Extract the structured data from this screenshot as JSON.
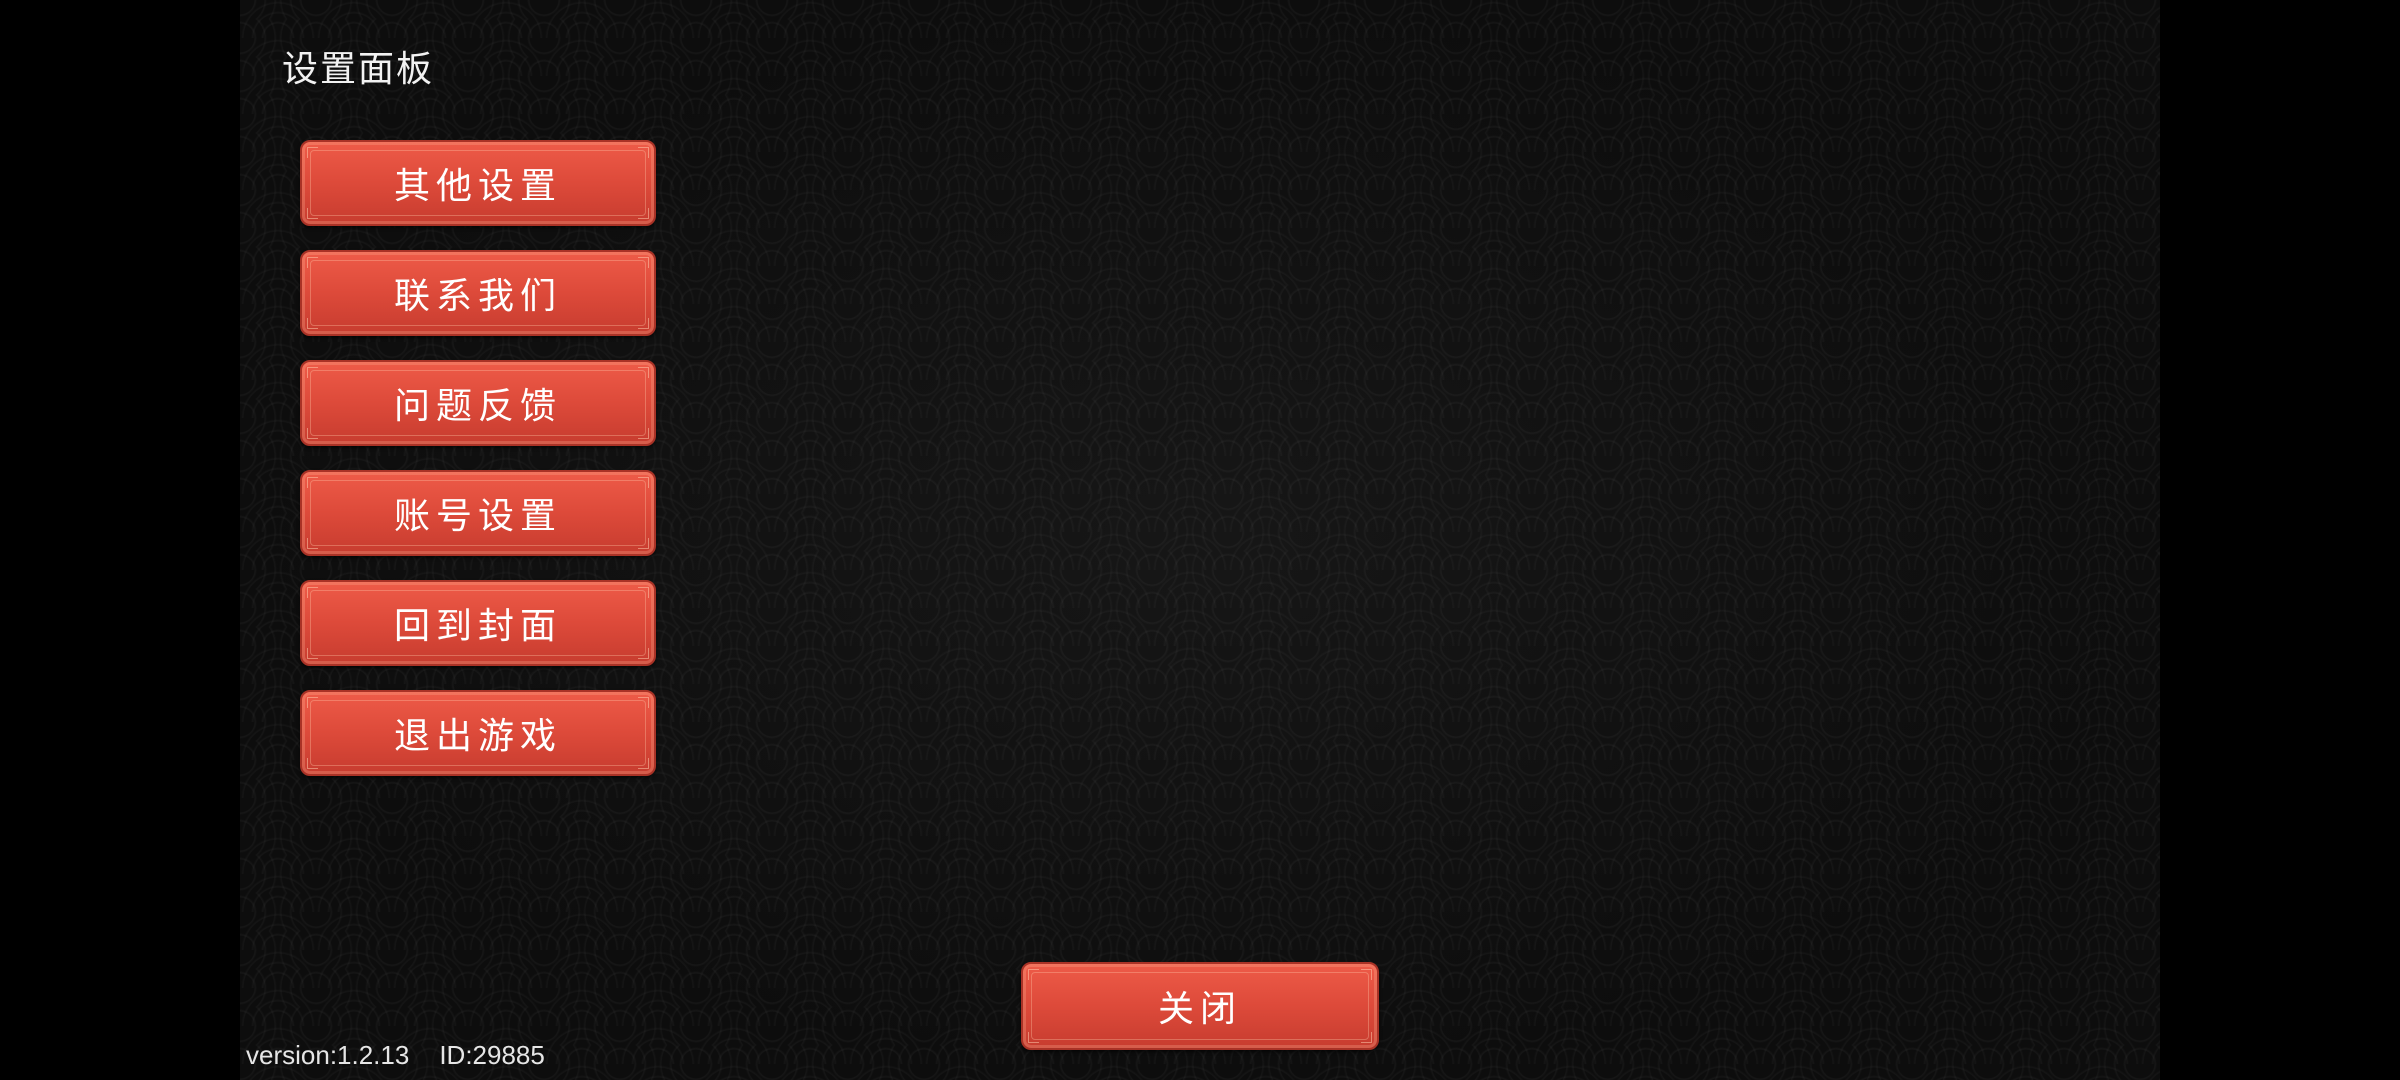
{
  "panel": {
    "title": "设置面板"
  },
  "menu": {
    "items": [
      {
        "label": "其他设置"
      },
      {
        "label": "联系我们"
      },
      {
        "label": "问题反馈"
      },
      {
        "label": "账号设置"
      },
      {
        "label": "回到封面"
      },
      {
        "label": "退出游戏"
      }
    ]
  },
  "close_button": {
    "label": "关闭"
  },
  "footer": {
    "version": "version:1.2.13",
    "id": "ID:29885"
  },
  "colors": {
    "button_red": "#dd4a3a",
    "background": "#0d0d0d",
    "text": "#ffffff"
  }
}
